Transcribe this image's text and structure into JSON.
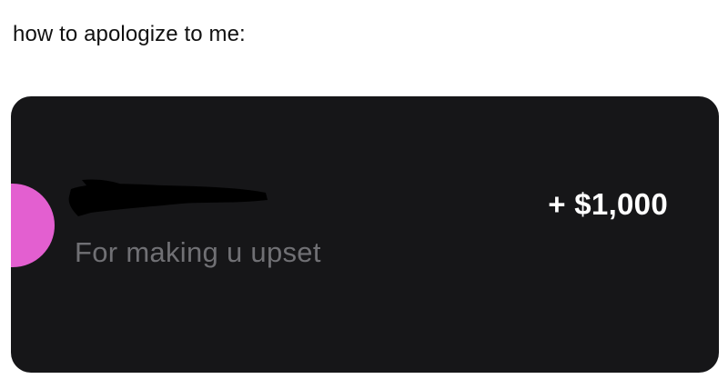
{
  "caption": "how to apologize to me:",
  "transaction": {
    "memo": "For making u upset",
    "amount": "+ $1,000",
    "avatar_color": "#e35fd0",
    "card_color": "#161618"
  }
}
